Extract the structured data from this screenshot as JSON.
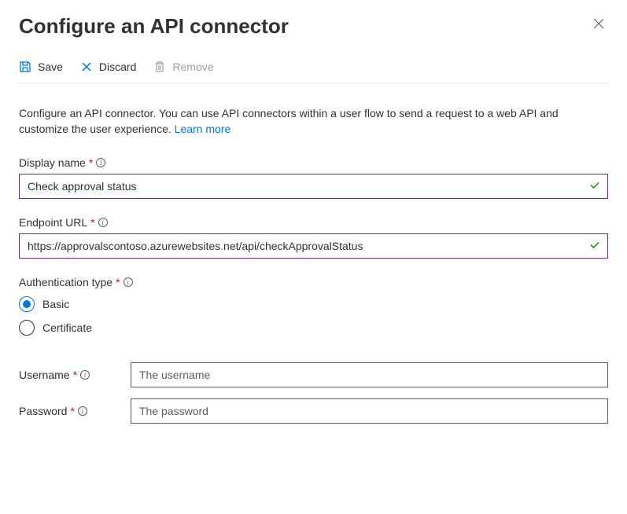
{
  "title": "Configure an API connector",
  "toolbar": {
    "save_label": "Save",
    "discard_label": "Discard",
    "remove_label": "Remove"
  },
  "description": {
    "text": "Configure an API connector. You can use API connectors within a user flow to send a request to a web API and customize the user experience.",
    "learn_more": "Learn more"
  },
  "fields": {
    "display_name": {
      "label": "Display name",
      "value": "Check approval status"
    },
    "endpoint_url": {
      "label": "Endpoint URL",
      "value": "https://approvalscontoso.azurewebsites.net/api/checkApprovalStatus"
    },
    "auth_type": {
      "label": "Authentication type",
      "options": {
        "basic": "Basic",
        "certificate": "Certificate"
      },
      "selected": "basic"
    },
    "username": {
      "label": "Username",
      "placeholder": "The username",
      "value": ""
    },
    "password": {
      "label": "Password",
      "placeholder": "The password",
      "value": ""
    }
  }
}
